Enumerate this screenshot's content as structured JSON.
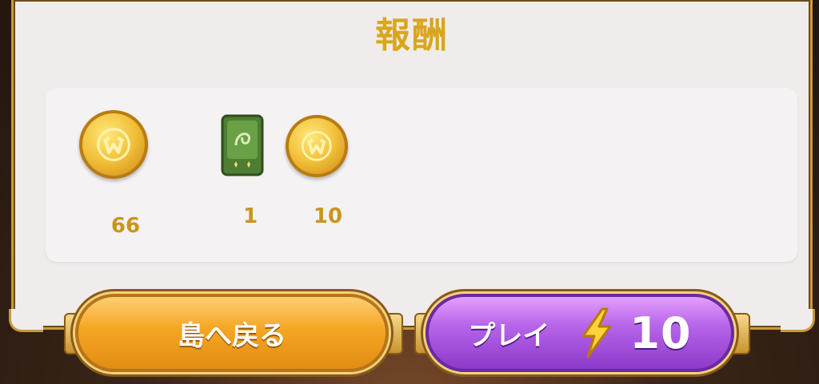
{
  "title": "報酬",
  "rewards": [
    {
      "icon": "gold-coin-icon",
      "quantity": "66"
    },
    {
      "icon": "green-card-pack-icon",
      "quantity": "1"
    },
    {
      "icon": "gold-coin-icon",
      "quantity": "10"
    }
  ],
  "buttons": {
    "back_label": "島へ戻る",
    "play_label": "プレイ",
    "play_cost": "10",
    "play_cost_icon": "lightning-bolt-icon"
  },
  "colors": {
    "title": "#d9a520",
    "quantity": "#c9951e",
    "back_button": "#f5a623",
    "play_button": "#a855e0"
  }
}
